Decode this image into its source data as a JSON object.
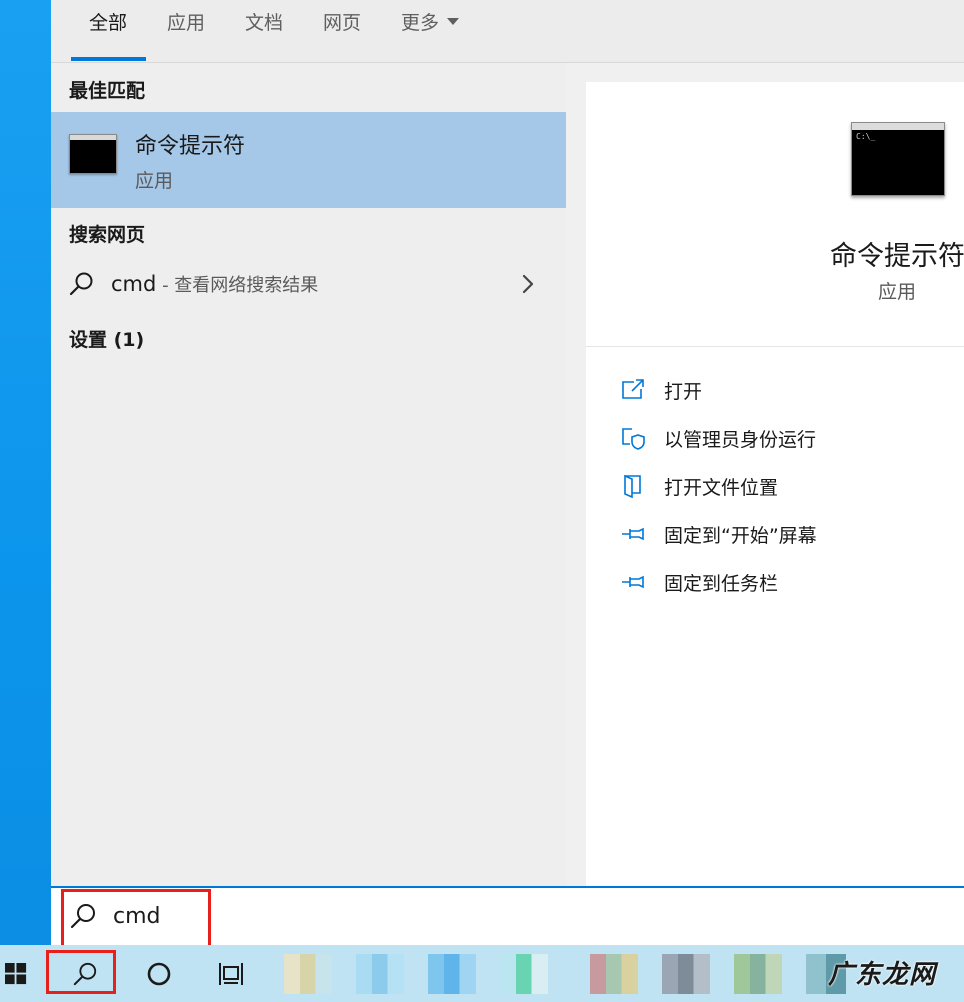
{
  "tabs": [
    {
      "label": "全部",
      "active": true
    },
    {
      "label": "应用",
      "active": false
    },
    {
      "label": "文档",
      "active": false
    },
    {
      "label": "网页",
      "active": false
    },
    {
      "label": "更多",
      "active": false
    }
  ],
  "left": {
    "best_match_heading": "最佳匹配",
    "best_match": {
      "title": "命令提示符",
      "subtitle": "应用",
      "icon": "command-prompt-icon"
    },
    "web_heading": "搜索网页",
    "web_result": {
      "query": "cmd",
      "hint": " - 查看网络搜索结果"
    },
    "settings_heading": "设置 (1)"
  },
  "right": {
    "app_title": "命令提示符",
    "app_subtitle": "应用",
    "thumb_prompt": "C:\\_",
    "actions": [
      {
        "label": "打开",
        "icon": "open-icon"
      },
      {
        "label": "以管理员身份运行",
        "icon": "shield-icon"
      },
      {
        "label": "打开文件位置",
        "icon": "file-location-icon"
      },
      {
        "label": "固定到“开始”屏幕",
        "icon": "pin-icon"
      },
      {
        "label": "固定到任务栏",
        "icon": "pin-icon"
      }
    ]
  },
  "search": {
    "value": "cmd"
  },
  "taskbar": {
    "icons": [
      "windows-start-icon",
      "search-icon",
      "cortana-icon",
      "task-view-icon"
    ]
  },
  "watermark": "广东龙网",
  "colors": {
    "accent": "#0078d7",
    "selection": "#a6c8e8",
    "highlight_box": "#e8201c",
    "taskbar": "#bfe3f3"
  }
}
